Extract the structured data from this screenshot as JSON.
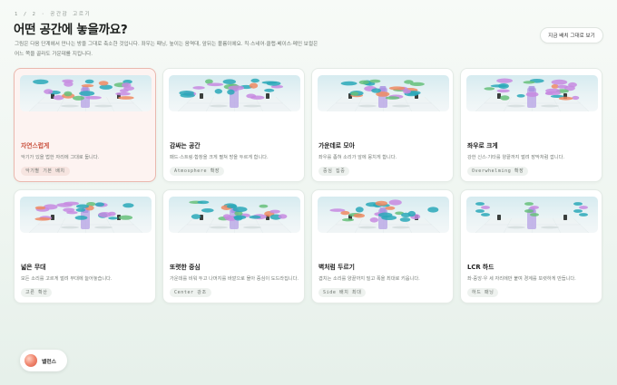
{
  "header": {
    "step": "1 / 2 · 공간감 고르기",
    "title": "어떤 공간에 놓을까요?",
    "description": "그림은 다음 단계에서 만나는 방을 그대로 축소한 것입니다. 좌우는 패닝, 높이는 음역대, 앞뒤는 볼륨이에요. 킥·스네어·클랩·베이스·메인 보컬은 어느 쪽을 골라도 가운데를 지킵니다.",
    "apply_button": "지금 배치 그대로 보기"
  },
  "cards": [
    {
      "title": "자연스럽게",
      "desc": "악기가 있을 법한 자리에 그대로 둡니다.",
      "tag": "악기별 기본 배치",
      "selected": true
    },
    {
      "title": "감싸는 공간",
      "desc": "패드·스트링·합창을 크게 펼쳐 방을 두르게 합니다.",
      "tag": "Atmosphere 확장",
      "selected": false
    },
    {
      "title": "가운데로 모아",
      "desc": "좌우를 좁혀 소리가 앞에 뭉치게 합니다.",
      "tag": "중심 집중",
      "selected": false
    },
    {
      "title": "좌우로 크게",
      "desc": "강한 신스·기타를 양끝까지 벌려 장막처럼 깝니다.",
      "tag": "Overwhelming 확장",
      "selected": false
    },
    {
      "title": "넓은 무대",
      "desc": "모든 소리를 고르게 벌려 무대에 늘어놓습니다.",
      "tag": "고른 확산",
      "selected": false
    },
    {
      "title": "또렷한 중심",
      "desc": "가운데를 비워 두고 나머지를 바깥으로 몰아 중심이 도드라집니다.",
      "tag": "Center 강조",
      "selected": false
    },
    {
      "title": "벽처럼 두르기",
      "desc": "겹치는 소리를 양끝까지 밀고 폭을 최대로 키웁니다.",
      "tag": "Side 배치 최대",
      "selected": false
    },
    {
      "title": "LCR 하드",
      "desc": "좌·중앙·우 세 자리에만 붙여 경계를 또렷하게 만듭니다.",
      "tag": "하드 패닝",
      "selected": false
    }
  ],
  "balance": {
    "label": "밸런스"
  },
  "colors": {
    "accent": "#c9513e",
    "selected_bg": "#fdf3f1",
    "blob_blue": "#2aa8b8",
    "blob_purple": "#c78ae0",
    "blob_orange": "#ee8a62",
    "blob_green": "#66c07a"
  }
}
